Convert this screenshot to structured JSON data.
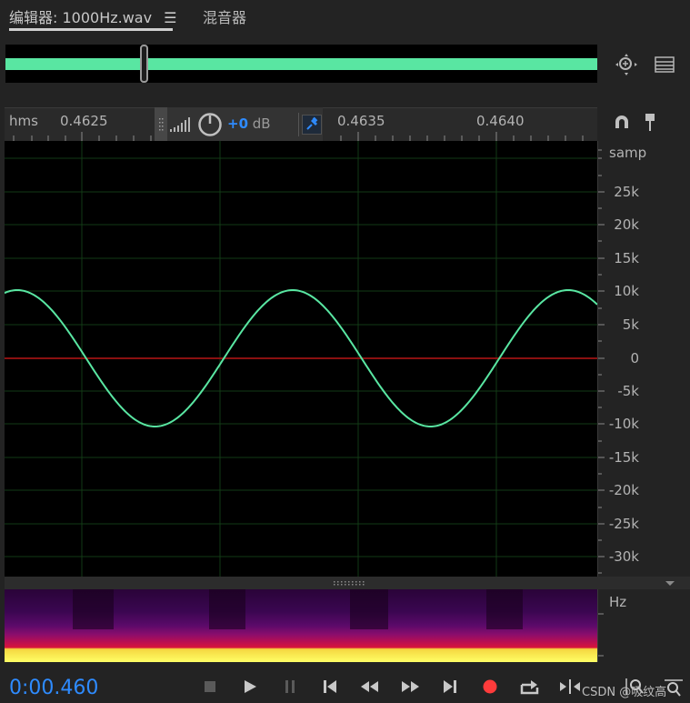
{
  "tabs": [
    {
      "label": "编辑器: 1000Hz.wav",
      "active": true
    },
    {
      "label": "混音器",
      "active": false
    }
  ],
  "ruler": {
    "unit": "hms",
    "ticks": [
      "0.4625",
      "0.4635",
      "0.4640"
    ]
  },
  "hud": {
    "db_value": "+0",
    "db_unit": " dB"
  },
  "amplitude_scale": {
    "unit": "samp",
    "labels": [
      "25k",
      "20k",
      "15k",
      "10k",
      "5k",
      "0",
      "-5k",
      "-10k",
      "-15k",
      "-20k",
      "-25k",
      "-30k"
    ]
  },
  "spectral": {
    "unit": "Hz"
  },
  "transport": {
    "time": "0:00.460"
  },
  "watermark": "CSDN @吸纹高",
  "colors": {
    "waveform": "#59e6a2",
    "accent": "#2e8bff",
    "record": "#ff3b3b",
    "zero_line": "#8a1010"
  }
}
